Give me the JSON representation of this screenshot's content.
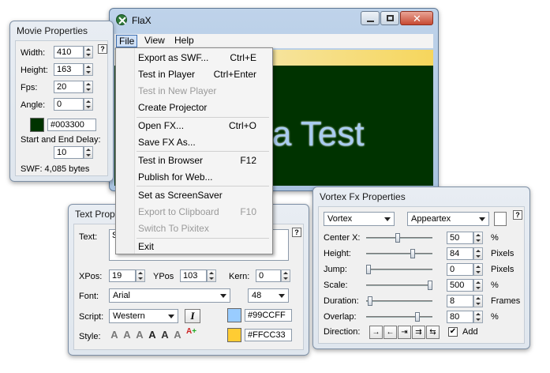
{
  "main_window": {
    "title": "FlaX",
    "menus": [
      "File",
      "View",
      "Help"
    ],
    "preview_text": "a Test"
  },
  "file_menu": {
    "items": [
      {
        "label": "Export as SWF...",
        "shortcut": "Ctrl+E",
        "enabled": true
      },
      {
        "label": "Test in Player",
        "shortcut": "Ctrl+Enter",
        "enabled": true
      },
      {
        "label": "Test in New Player",
        "shortcut": "",
        "enabled": false
      },
      {
        "label": "Create Projector",
        "shortcut": "",
        "enabled": true
      },
      {
        "label": "Open FX...",
        "shortcut": "Ctrl+O",
        "enabled": true
      },
      {
        "label": "Save FX As...",
        "shortcut": "",
        "enabled": true
      },
      {
        "label": "Test in Browser",
        "shortcut": "F12",
        "enabled": true
      },
      {
        "label": "Publish for Web...",
        "shortcut": "",
        "enabled": true
      },
      {
        "label": "Set as ScreenSaver",
        "shortcut": "",
        "enabled": true
      },
      {
        "label": "Export to Clipboard",
        "shortcut": "F10",
        "enabled": false
      },
      {
        "label": "Switch To Pixitex",
        "shortcut": "",
        "enabled": false
      },
      {
        "label": "Exit",
        "shortcut": "",
        "enabled": true
      }
    ]
  },
  "movie_properties": {
    "title": "Movie Properties",
    "width_label": "Width:",
    "width": "410",
    "height_label": "Height:",
    "height": "163",
    "fps_label": "Fps:",
    "fps": "20",
    "angle_label": "Angle:",
    "angle": "0",
    "color_hex": "#003300",
    "delay_label": "Start and End Delay:",
    "delay": "10",
    "swf_size": "SWF: 4,085 bytes",
    "help": "?"
  },
  "text_properties": {
    "title": "Text Properties",
    "text_label": "Text:",
    "text_value": "S",
    "xpos_label": "XPos:",
    "xpos": "19",
    "ypos_label": "YPos",
    "ypos": "103",
    "kern_label": "Kern:",
    "kern": "0",
    "font_label": "Font:",
    "font": "Arial",
    "font_size": "48",
    "script_label": "Script:",
    "script": "Western",
    "italic": "I",
    "color1_hex": "#99CCFF",
    "style_label": "Style:",
    "color2_hex": "#FFCC33",
    "help": "?"
  },
  "vortex_properties": {
    "title": "Vortex Fx Properties",
    "effect": "Vortex",
    "preset": "Appeartex",
    "help": "?",
    "rows": [
      {
        "label": "Center X:",
        "value": "50",
        "unit": "%",
        "slider": 0.48
      },
      {
        "label": "Height:",
        "value": "84",
        "unit": "Pixels",
        "slider": 0.72
      },
      {
        "label": "Jump:",
        "value": "0",
        "unit": "Pixels",
        "slider": 0.0
      },
      {
        "label": "Scale:",
        "value": "500",
        "unit": "%",
        "slider": 1.0
      },
      {
        "label": "Duration:",
        "value": "8",
        "unit": "Frames",
        "slider": 0.03
      },
      {
        "label": "Overlap:",
        "value": "80",
        "unit": "%",
        "slider": 0.8
      }
    ],
    "direction_label": "Direction:",
    "add_label": "Add",
    "add_checked": true
  },
  "colors": {
    "movie_bg": "#003300",
    "swatch1": "#99CCFF",
    "swatch2": "#FFCC33"
  }
}
